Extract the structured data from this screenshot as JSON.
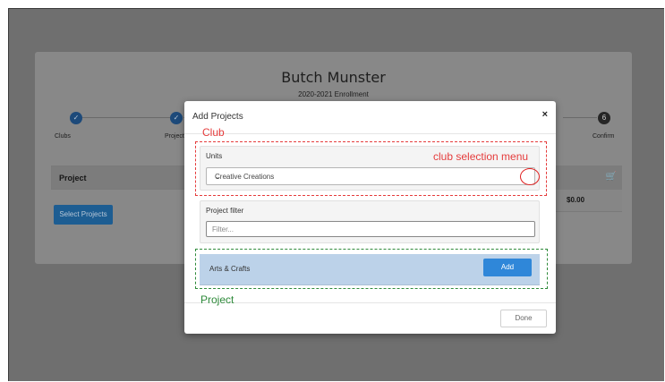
{
  "background": {
    "title": "Butch Munster",
    "subtitle": "2020-2021 Enrollment",
    "steps": [
      {
        "label": "Clubs"
      },
      {
        "label": "Projects"
      },
      {
        "label": "Confirm",
        "number": "6"
      }
    ],
    "table_header": "Project",
    "total": "$0.00",
    "select_projects_button": "Select Projects"
  },
  "modal": {
    "title": "Add Projects",
    "close": "×",
    "units_label": "Units",
    "units_selected": "Creative Creations",
    "filter_label": "Project filter",
    "filter_placeholder": "Filter...",
    "project_name": "Arts & Crafts",
    "add_button": "Add",
    "done_button": "Done"
  },
  "annotations": {
    "club": "Club",
    "club_selection_menu": "club selection menu",
    "project": "Project"
  },
  "colors": {
    "annotation_red": "#e53c3c",
    "annotation_green": "#2e8a3a",
    "primary_blue": "#2f87d9"
  }
}
